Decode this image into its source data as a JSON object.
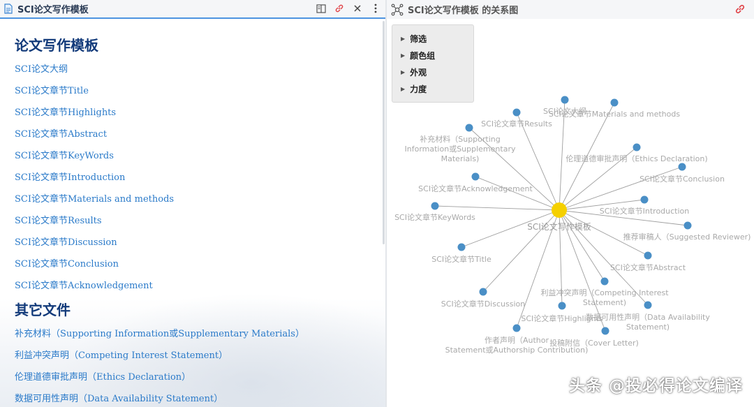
{
  "left_tab": {
    "title": "SCI论文写作模板"
  },
  "doc": {
    "heading1": "论文写作模板",
    "links1": [
      "SCI论文大纲",
      "SCI论文章节Title",
      "SCI论文章节Highlights",
      "SCI论文章节Abstract",
      "SCI论文章节KeyWords",
      "SCI论文章节Introduction",
      "SCI论文章节Materials and methods",
      "SCI论文章节Results",
      "SCI论文章节Discussion",
      "SCI论文章节Conclusion",
      "SCI论文章节Acknowledgement"
    ],
    "heading2": "其它文件",
    "links2": [
      "补充材料（Supporting Information或Supplementary Materials）",
      "利益冲突声明（Competing Interest Statement）",
      "伦理道德审批声明（Ethics Declaration）",
      "数据可用性声明（Data Availability Statement）"
    ]
  },
  "right_tab": {
    "title": "SCI论文写作模板 的关系图"
  },
  "panel": {
    "items": [
      "筛选",
      "颜色组",
      "外观",
      "力度"
    ]
  },
  "graph": {
    "center_label": "SCI论文写作模板",
    "center_color": "#f5d000",
    "node_color": "#4a8fc6",
    "edge_color": "#9e9e9e",
    "node_labels": [
      "SCI论文大纲",
      "SCI论文章节Materials and methods",
      "SCI论文章节Results",
      "补充材料（Supporting",
      "Information或Supplementary",
      "Materials)",
      "伦理道德审批声明（Ethics Declaration)",
      "SCI论文章节Conclusion",
      "SCI论文章节Acknowledgement",
      "SCI论文章节Introduction",
      "SCI论文章节KeyWords",
      "推荐审稿人（Suggested Reviewer)",
      "SCI论文章节Title",
      "SCI论文章节Abstract",
      "利益冲突声明（Competing Interest",
      "Statement)",
      "SCI论文章节Discussion",
      "数据可用性声明（Data Availability",
      "Statement)",
      "SCI论文章节Highlights",
      "作者声明（Author",
      "Statement或Authorship Contribution)",
      "投稿附信（Cover Letter)"
    ]
  },
  "watermark": "头条 @投必得论文编译"
}
